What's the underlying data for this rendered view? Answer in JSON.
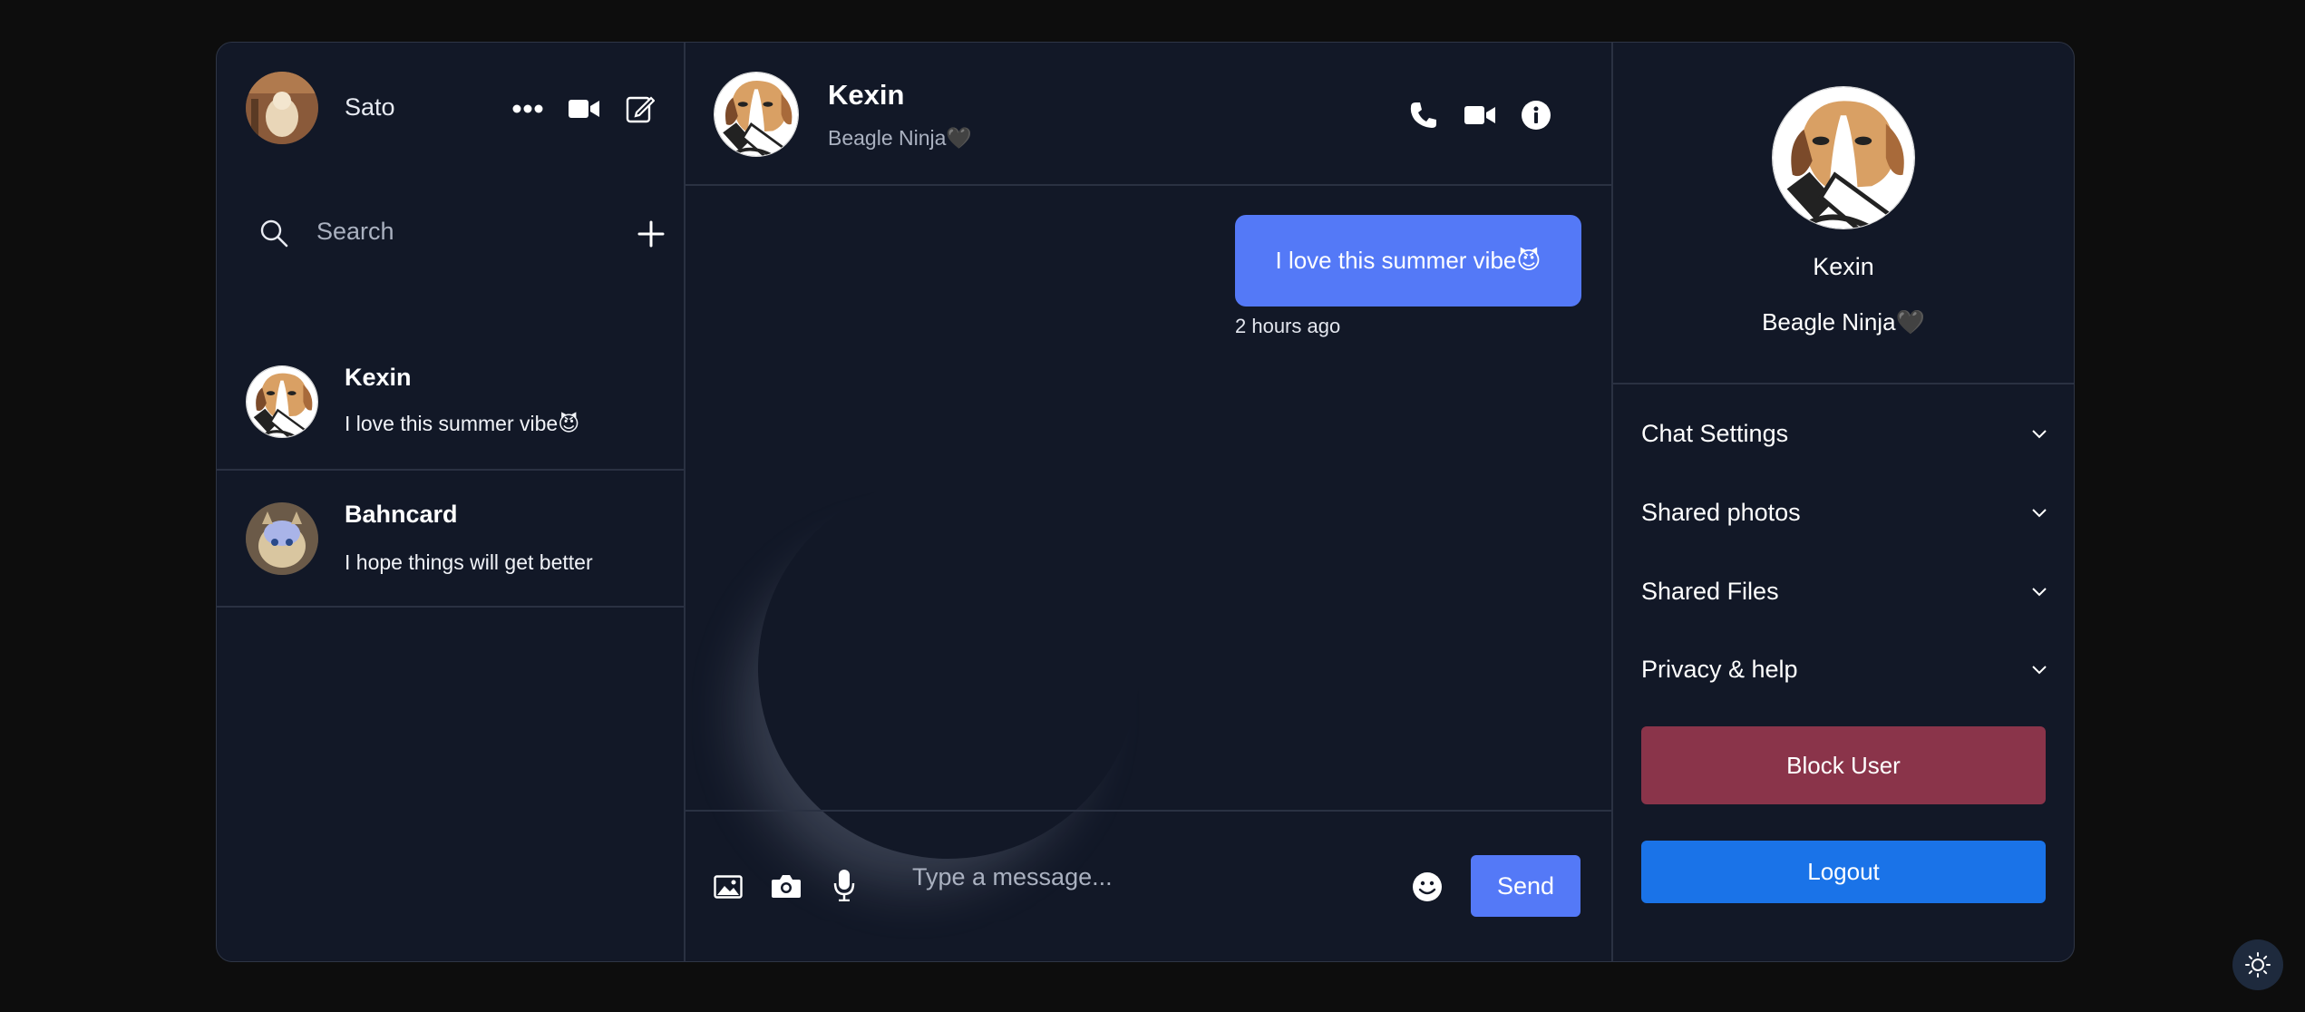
{
  "user": {
    "name": "Sato"
  },
  "search": {
    "placeholder": "Search"
  },
  "conversations": [
    {
      "name": "Kexin",
      "last_message": "I love this summer vibe😈"
    },
    {
      "name": "Bahncard",
      "last_message": "I hope things will get better"
    }
  ],
  "chat": {
    "peer_name": "Kexin",
    "peer_status": "Beagle Ninja🖤",
    "messages": [
      {
        "text": "I love this summer vibe😈",
        "time": "2 hours ago",
        "sent": true
      }
    ],
    "input_placeholder": "Type a message...",
    "send_label": "Send"
  },
  "profile": {
    "name": "Kexin",
    "status": "Beagle Ninja🖤",
    "sections": [
      "Chat Settings",
      "Shared photos",
      "Shared Files",
      "Privacy & help"
    ],
    "block_label": "Block User",
    "logout_label": "Logout"
  },
  "colors": {
    "accent": "#5479f7",
    "background": "#121827",
    "block": "#8a344a",
    "logout": "#1a73e8"
  },
  "icons": [
    "more-icon",
    "video-icon",
    "edit-icon",
    "search-icon",
    "plus-icon",
    "phone-icon",
    "info-icon",
    "image-icon",
    "camera-icon",
    "mic-icon",
    "emoji-icon",
    "chevron-down-icon",
    "sun-icon"
  ]
}
